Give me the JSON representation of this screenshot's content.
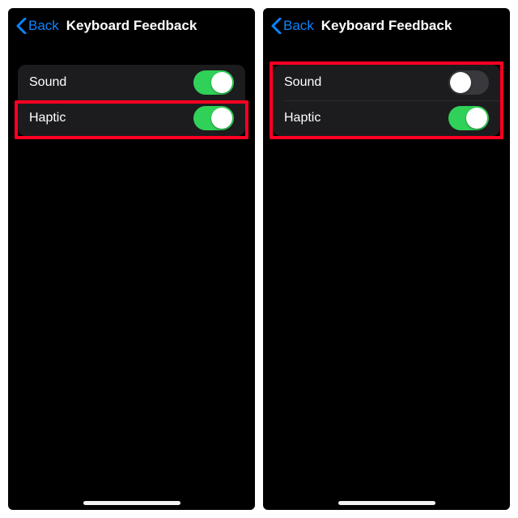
{
  "colors": {
    "accent_blue": "#0a84ff",
    "toggle_on": "#30d158",
    "toggle_off": "#39393d",
    "highlight": "#ff0022"
  },
  "screens": [
    {
      "key": "left",
      "back_label": "Back",
      "title": "Keyboard Feedback",
      "rows": [
        {
          "key": "sound",
          "label": "Sound",
          "checked": true,
          "highlighted": false
        },
        {
          "key": "haptic",
          "label": "Haptic",
          "checked": true,
          "highlighted": true,
          "highlight_target": "row"
        }
      ]
    },
    {
      "key": "right",
      "back_label": "Back",
      "title": "Keyboard Feedback",
      "highlight_group": true,
      "rows": [
        {
          "key": "sound",
          "label": "Sound",
          "checked": false,
          "highlighted": true,
          "highlight_target": "group"
        },
        {
          "key": "haptic",
          "label": "Haptic",
          "checked": true,
          "highlighted": true,
          "highlight_target": "group"
        }
      ]
    }
  ]
}
